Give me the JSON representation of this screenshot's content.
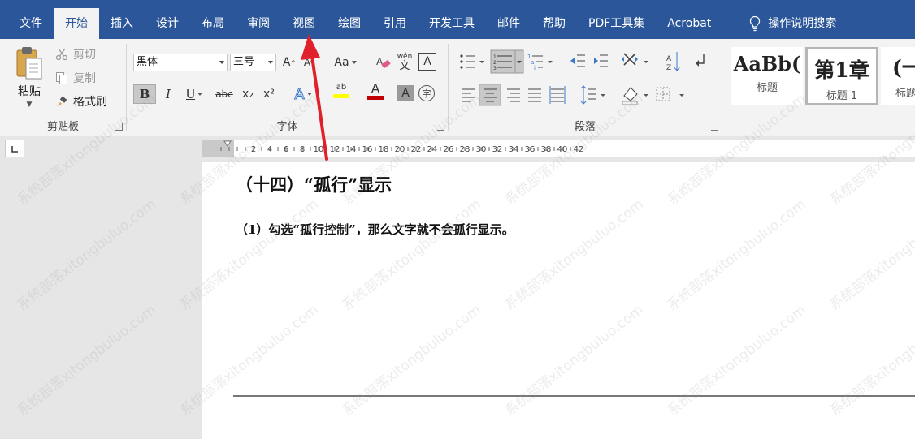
{
  "menu": {
    "tabs": [
      "文件",
      "开始",
      "插入",
      "设计",
      "布局",
      "审阅",
      "视图",
      "绘图",
      "引用",
      "开发工具",
      "邮件",
      "帮助",
      "PDF工具集",
      "Acrobat"
    ],
    "active_tab": "开始",
    "tell_me": "操作说明搜索"
  },
  "ribbon": {
    "clipboard": {
      "paste": "粘贴",
      "cut": "剪切",
      "copy": "复制",
      "format_painter": "格式刷",
      "label": "剪贴板"
    },
    "font": {
      "font_name": "黑体",
      "font_size": "三号",
      "grow": "A",
      "shrink": "A",
      "change_case": "Aa",
      "phonetic": "wén",
      "phonetic_char": "文",
      "char_border": "A",
      "bold": "B",
      "italic": "I",
      "underline": "U",
      "strike": "abc",
      "subscript": "x₂",
      "superscript": "x²",
      "text_effect": "A",
      "highlight": "ab",
      "font_color": "A",
      "char_shading": "A",
      "enclose": "字",
      "label": "字体"
    },
    "paragraph": {
      "label": "段落"
    },
    "styles": [
      {
        "preview": "AaBb(",
        "name": "标题"
      },
      {
        "preview": "第1章",
        "name": "标题 1"
      },
      {
        "preview": "(一",
        "name": "标题"
      }
    ]
  },
  "ruler": {
    "labels": [
      "2",
      "4",
      "6",
      "8",
      "10",
      "12",
      "14",
      "16",
      "18",
      "20",
      "22",
      "24",
      "26",
      "28",
      "30",
      "32",
      "34",
      "36",
      "38",
      "40",
      "42"
    ]
  },
  "document": {
    "heading": "（十四）“孤行”显示",
    "paragraph": "（1）勾选“孤行控制”，那么文字就不会孤行显示。"
  },
  "watermark": "系统部落xitongbuluo.com",
  "colors": {
    "ribbon_blue": "#2b579a",
    "arrow_red": "#e0202a"
  }
}
